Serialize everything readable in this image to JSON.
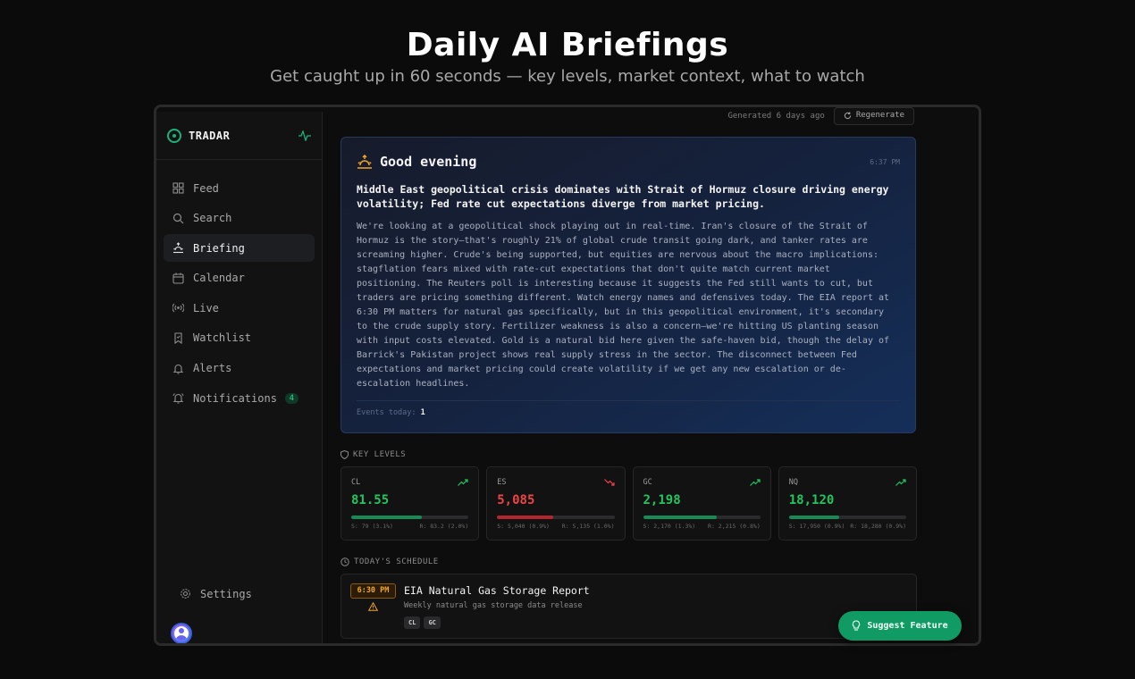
{
  "hero": {
    "title": "Daily AI Briefings",
    "subtitle": "Get caught up in 60 seconds — key levels, market context, what to watch"
  },
  "app": {
    "brand": "TRADAR",
    "brand_icon": "radar-logo-icon",
    "accent": "#19b37a"
  },
  "sidebar": {
    "items": [
      {
        "label": "Feed",
        "icon": "grid-icon",
        "active": false
      },
      {
        "label": "Search",
        "icon": "search-icon",
        "active": false
      },
      {
        "label": "Briefing",
        "icon": "sunrise-icon",
        "active": true
      },
      {
        "label": "Calendar",
        "icon": "calendar-icon",
        "active": false
      },
      {
        "label": "Live",
        "icon": "broadcast-icon",
        "active": false
      },
      {
        "label": "Watchlist",
        "icon": "bookmark-icon",
        "active": false
      },
      {
        "label": "Alerts",
        "icon": "bell-icon",
        "active": false
      },
      {
        "label": "Notifications",
        "icon": "bell-ring-icon",
        "active": false,
        "badge": "4"
      }
    ],
    "settings_label": "Settings"
  },
  "header": {
    "generated": "Generated 6 days ago",
    "regenerate_label": "Regenerate"
  },
  "briefing": {
    "greeting": "Good evening",
    "time": "6:37 PM",
    "headline": "Middle East geopolitical crisis dominates with Strait of Hormuz closure driving energy volatility; Fed rate cut expectations diverge from market pricing.",
    "body": "We're looking at a geopolitical shock playing out in real-time. Iran's closure of the Strait of Hormuz is the story—that's roughly 21% of global crude transit going dark, and tanker rates are screaming higher. Crude's being supported, but equities are nervous about the macro implications: stagflation fears mixed with rate-cut expectations that don't quite match current market positioning. The Reuters poll is interesting because it suggests the Fed still wants to cut, but traders are pricing something different. Watch energy names and defensives today. The EIA report at 6:30 PM matters for natural gas specifically, but in this geopolitical environment, it's secondary to the crude supply story. Fertilizer weakness is also a concern—we're hitting US planting season with input costs elevated. Gold is a natural bid here given the safe-haven bid, though the delay of Barrick's Pakistan project shows real supply stress in the sector. The disconnect between Fed expectations and market pricing could create volatility if we get any new escalation or de-escalation headlines.",
    "events_label": "Events today:",
    "events_count": "1"
  },
  "key_levels": {
    "label": "KEY LEVELS",
    "items": [
      {
        "symbol": "CL",
        "price": "81.55",
        "direction": "up",
        "color": "#22c55e",
        "progress": 0.6,
        "support": "S: 79 (3.1%)",
        "resistance": "R: 83.2 (2.0%)"
      },
      {
        "symbol": "ES",
        "price": "5,085",
        "direction": "down",
        "color": "#ef4444",
        "progress": 0.48,
        "support": "S: 5,040 (0.9%)",
        "resistance": "R: 5,135 (1.0%)"
      },
      {
        "symbol": "GC",
        "price": "2,198",
        "direction": "up",
        "color": "#22c55e",
        "progress": 0.63,
        "support": "S: 2,170 (1.3%)",
        "resistance": "R: 2,215 (0.8%)"
      },
      {
        "symbol": "NQ",
        "price": "18,120",
        "direction": "up",
        "color": "#22c55e",
        "progress": 0.43,
        "support": "S: 17,950 (0.9%)",
        "resistance": "R: 18,280 (0.9%)"
      }
    ]
  },
  "schedule": {
    "label": "TODAY'S SCHEDULE",
    "events": [
      {
        "time": "6:30 PM",
        "title": "EIA Natural Gas Storage Report",
        "description": "Weekly natural gas storage data release",
        "tags": [
          "CL",
          "GC"
        ],
        "impact_icon": "warning-icon"
      }
    ]
  },
  "suggest_label": "Suggest Feature"
}
